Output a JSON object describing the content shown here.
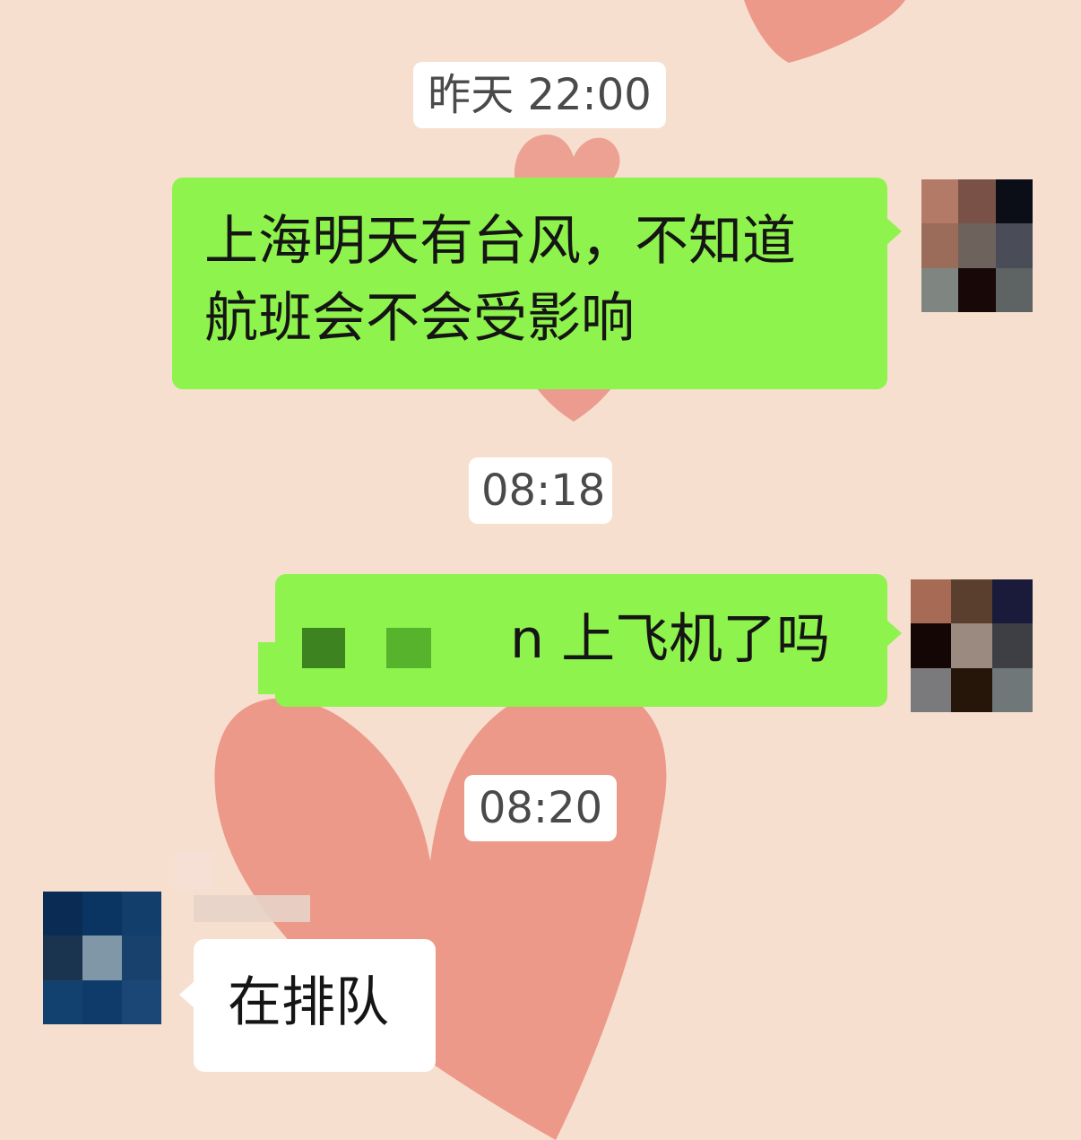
{
  "chat": {
    "background_color": "#f7dfd0",
    "heart_color": "#ea9182",
    "outgoing_bubble_color": "#8ef34c",
    "incoming_bubble_color": "#ffffff",
    "timestamps": [
      "昨天 22:00",
      "08:18",
      "08:20"
    ],
    "messages": [
      {
        "direction": "outgoing",
        "line1": "上海明天有台风，不知道",
        "line2": "航班会不会受影响"
      },
      {
        "direction": "outgoing",
        "visible_text": "n 上飞机了吗"
      },
      {
        "direction": "incoming",
        "text": "在排队"
      }
    ]
  }
}
